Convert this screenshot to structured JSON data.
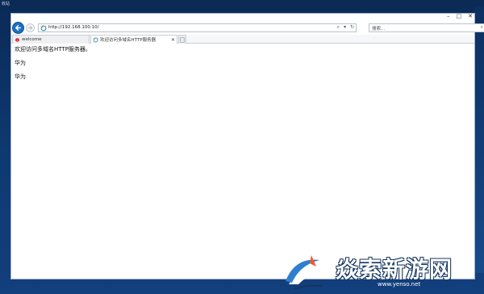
{
  "desktop": {
    "caption": "收站"
  },
  "window": {
    "controls": {
      "minimize": "–",
      "maximize": "□",
      "close": "✕"
    }
  },
  "navigation": {
    "address": "http://192.168.100.10/",
    "address_tools": {
      "search": "⌕",
      "dropdown": "▾",
      "refresh": "↻"
    },
    "search_placeholder": "搜索...",
    "search_tools": {
      "search": "⌕",
      "dropdown": "▾"
    }
  },
  "tabs": [
    {
      "label": "welcome",
      "active": false,
      "icon": "huawei-icon"
    },
    {
      "label": "欢迎访问多域名HTTP服务器",
      "active": true,
      "icon": "ie-icon",
      "close": "✕"
    }
  ],
  "page": {
    "lines": [
      "欢迎访问多域名HTTP服务器。",
      "华为",
      "华为"
    ]
  },
  "watermark": {
    "chars": "焱索新游网",
    "url": "www.yenso.net"
  },
  "colors": {
    "accent": "#1c6fc4",
    "desktop": "#0e3a73"
  }
}
